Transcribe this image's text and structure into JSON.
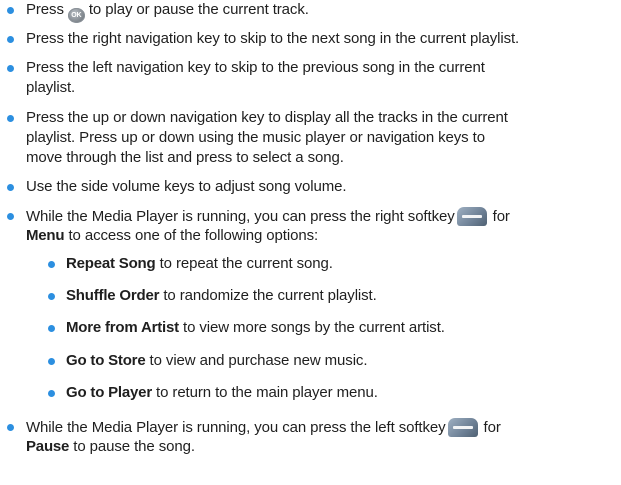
{
  "ok_icon_label": "OK",
  "icons": [
    "ok-key-icon",
    "right-softkey-icon",
    "left-softkey-icon"
  ],
  "bullet_color": "#2c8fe0",
  "items": {
    "i0": {
      "a": "Press",
      "b": "to play or pause the current track."
    },
    "i1": {
      "l1": "Press the right navigation key to skip to the next song in the current playlist."
    },
    "i2": {
      "l1": "Press the left navigation key to skip to the previous song in the current",
      "l2": "playlist."
    },
    "i3": {
      "l1": "Press the up or down navigation key to display all the tracks in the current",
      "l2": "playlist. Press up or down using the music player or navigation keys to",
      "l3": "move through the list and press to select a song."
    },
    "i4": {
      "l1": "Use the side volume keys to adjust song volume."
    },
    "i5": {
      "l1a": "While the Media Player is running, you can press the right softkey",
      "l1b": "for",
      "l2b": "Menu",
      "l2c": "to access one of the following options:"
    },
    "s0": {
      "b": "Repeat Song",
      "t": "to repeat the current song."
    },
    "s1": {
      "b": "Shuffle Order",
      "t": "to randomize the current playlist."
    },
    "s2": {
      "b": "More from Artist",
      "t": "to view more songs by the current artist."
    },
    "s3": {
      "b": "Go to Store",
      "t": "to view and purchase new music."
    },
    "s4": {
      "b": "Go to Player",
      "t": "to return to the main player menu."
    },
    "i6": {
      "l1a": "While the Media Player is running, you can press the left softkey",
      "l1b": "for",
      "l2b": "Pause",
      "l2c": "to pause the song."
    }
  }
}
